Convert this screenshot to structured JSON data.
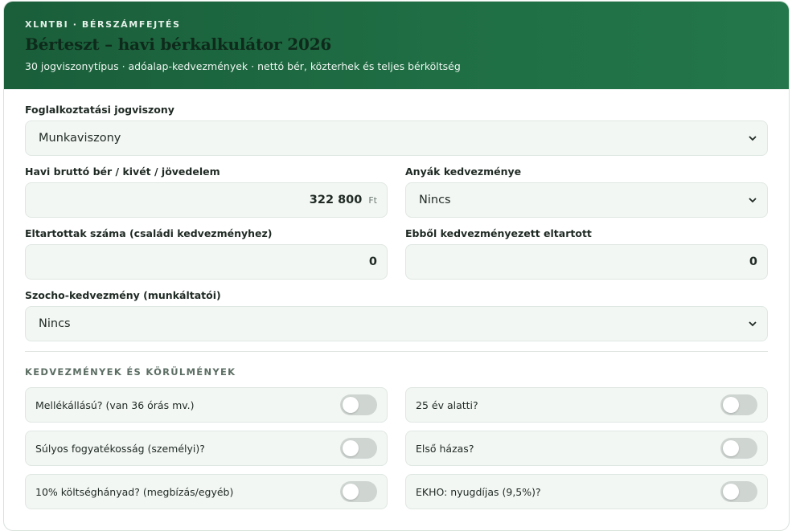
{
  "header": {
    "eyebrow": "XLNTBI · BÉRSZÁMFEJTÉS",
    "title": "Bérteszt – havi bérkalkulátor 2026",
    "subtitle": "30 jogviszonytípus · adóalap-kedvezmények · nettó bér, közterhek és teljes bérköltség"
  },
  "form": {
    "employment": {
      "label": "Foglalkoztatási jogviszony",
      "value": "Munkaviszony"
    },
    "gross": {
      "label": "Havi bruttó bér / kivét / jövedelem",
      "value": "322 800",
      "unit": "Ft"
    },
    "mothers": {
      "label": "Anyák kedvezménye",
      "value": "Nincs"
    },
    "dependents": {
      "label": "Eltartottak száma (családi kedvezményhez)",
      "value": "0"
    },
    "beneficiary": {
      "label": "Ebből kedvezményezett eltartott",
      "value": "0"
    },
    "szocho": {
      "label": "Szocho-kedvezmény (munkáltatói)",
      "value": "Nincs"
    }
  },
  "section": {
    "title": "KEDVEZMÉNYEK ÉS KÖRÜLMÉNYEK",
    "toggles": [
      {
        "label": "Mellékállású? (van 36 órás mv.)",
        "on": false
      },
      {
        "label": "25 év alatti?",
        "on": false
      },
      {
        "label": "Súlyos fogyatékosság (személyi)?",
        "on": false
      },
      {
        "label": "Első házas?",
        "on": false
      },
      {
        "label": "10% költséghányad? (megbízás/egyéb)",
        "on": false
      },
      {
        "label": "EKHO: nyugdíjas (9,5%)?",
        "on": false
      }
    ]
  }
}
